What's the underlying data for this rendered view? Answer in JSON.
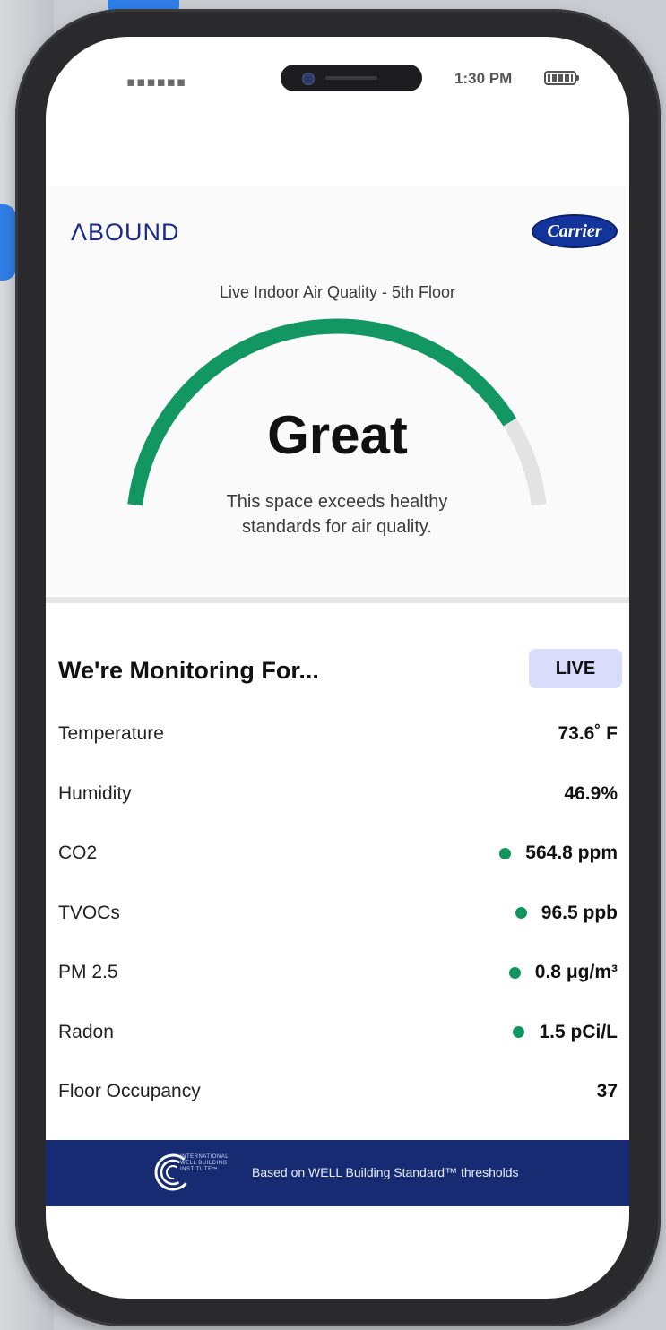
{
  "status_bar": {
    "signal": "▪▪▪▪▪▪",
    "time": "1:30 PM"
  },
  "brand": {
    "abound": "ΛBOUND",
    "carrier": "Carrier"
  },
  "air_quality": {
    "subtitle": "Live Indoor Air Quality - 5th Floor",
    "status": "Great",
    "description": "This space exceeds healthy standards for air quality.",
    "gauge_level": 0.85,
    "gauge_color": "#139762",
    "gauge_track_color": "#e3e3e3"
  },
  "monitoring": {
    "title": "We're Monitoring For...",
    "live_label": "LIVE",
    "metrics": [
      {
        "label": "Temperature",
        "value": "73.6˚ F",
        "indicator": false
      },
      {
        "label": "Humidity",
        "value": "46.9%",
        "indicator": false
      },
      {
        "label": "CO2",
        "value": "564.8 ppm",
        "indicator": true
      },
      {
        "label": "TVOCs",
        "value": "96.5 ppb",
        "indicator": true
      },
      {
        "label": "PM 2.5",
        "value": "0.8 μg/m³",
        "indicator": true
      },
      {
        "label": "Radon",
        "value": "1.5 pCi/L",
        "indicator": true
      },
      {
        "label": "Floor Occupancy",
        "value": "37",
        "indicator": false
      }
    ]
  },
  "footer": {
    "well_logo_text": "INTERNATIONAL WELL BUILDING INSTITUTE™",
    "note": "Based on WELL Building Standard™ thresholds"
  },
  "colors": {
    "brand_navy": "#172b73",
    "status_green": "#11955f",
    "live_badge_bg": "#d9dcfb"
  }
}
